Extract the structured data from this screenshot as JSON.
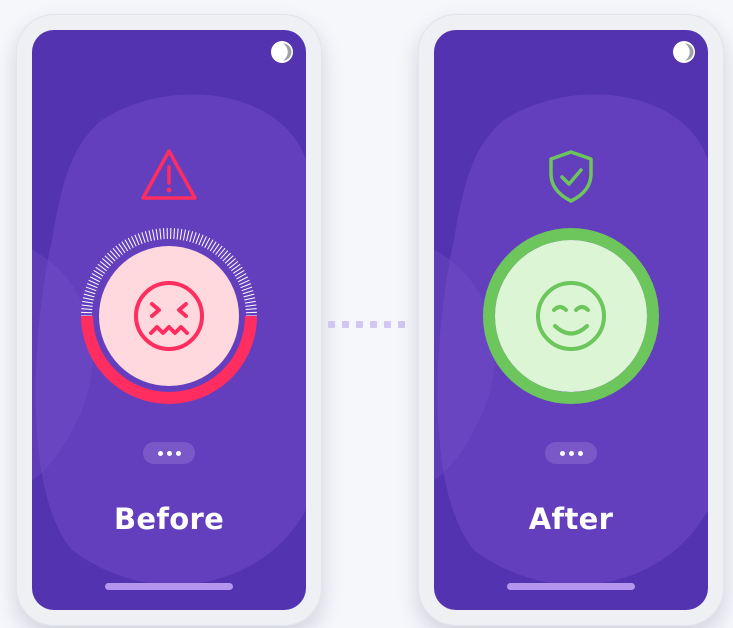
{
  "screens": [
    {
      "id": "before",
      "caption": "Before",
      "status_icon": "warning-triangle-icon",
      "mood_icon": "distressed-face-icon",
      "more_icon": "ellipsis-icon",
      "theme_icon": "moon-icon",
      "ring_progress": 0.5
    },
    {
      "id": "after",
      "caption": "After",
      "status_icon": "shield-check-icon",
      "mood_icon": "smiling-face-icon",
      "more_icon": "ellipsis-icon",
      "theme_icon": "moon-icon",
      "ring_progress": 1
    }
  ],
  "connector": {
    "icon": "dotted-connector"
  },
  "colors": {
    "page_background": "#f6f7fb",
    "screen_purple": "#5433b0",
    "blob_purple": "#6a44c2",
    "danger": "#ff2d60",
    "danger_fill": "#ffd9dd",
    "success": "#6cc65c",
    "success_fill": "#dcf5d5",
    "pill": "#7a58c8",
    "home_indicator": "#b496ef",
    "connector": "#d2c7f2"
  }
}
